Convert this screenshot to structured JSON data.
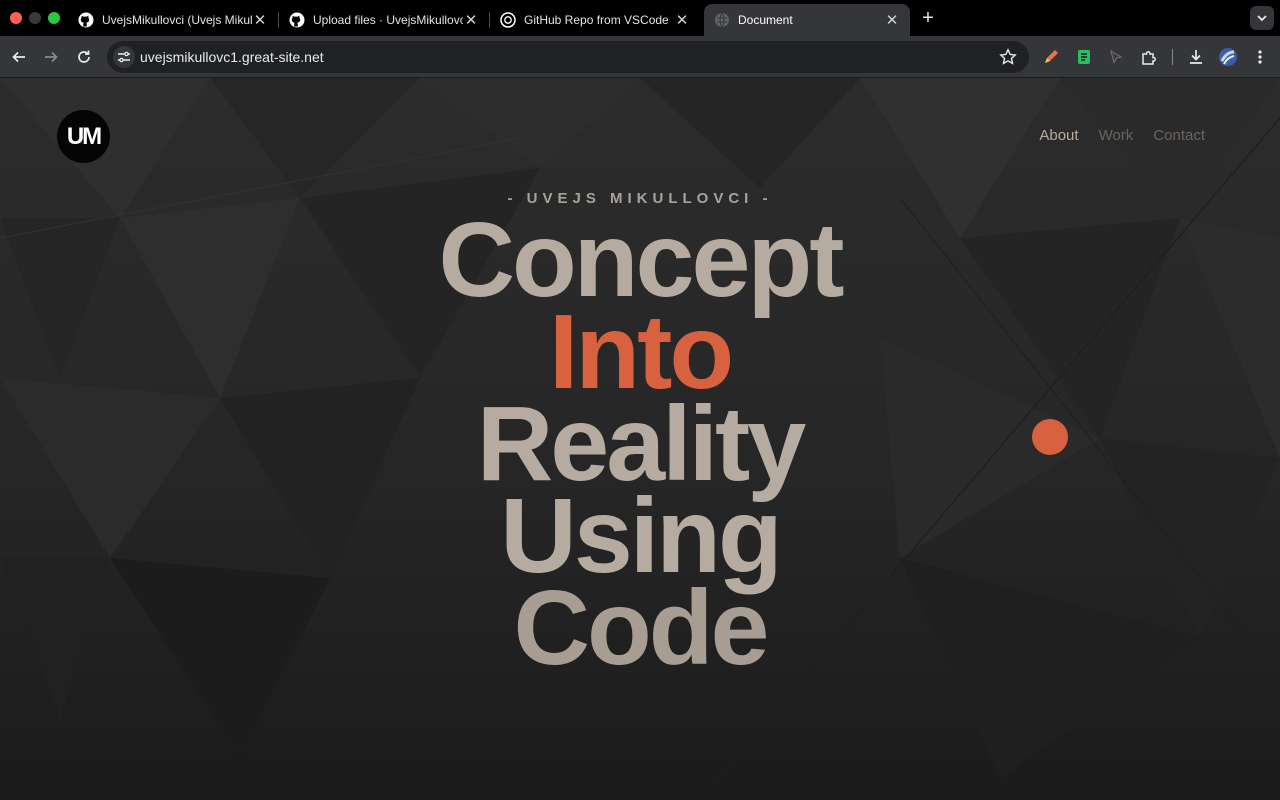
{
  "browser": {
    "tabs": [
      {
        "title": "UvejsMikullovci (Uvejs Mikullovci)",
        "icon": "github-icon"
      },
      {
        "title": "Upload files · UvejsMikullovci/UvejsMikullovci",
        "icon": "github-icon"
      },
      {
        "title": "GitHub Repo from VSCode",
        "icon": "openai-icon"
      },
      {
        "title": "Document",
        "icon": "globe-icon",
        "active": true
      }
    ],
    "url": "uvejsmikullovc1.great-site.net"
  },
  "site": {
    "logo": "UM",
    "nav": [
      {
        "label": "About",
        "active": true
      },
      {
        "label": "Work"
      },
      {
        "label": "Contact"
      }
    ],
    "eyebrow": "- UVEJS MIKULLOVCI -",
    "headline": [
      "Concept",
      "Into",
      "Reality",
      "Using",
      "Code"
    ],
    "accent_color": "#d8613f",
    "text_color": "#b5aba0"
  }
}
